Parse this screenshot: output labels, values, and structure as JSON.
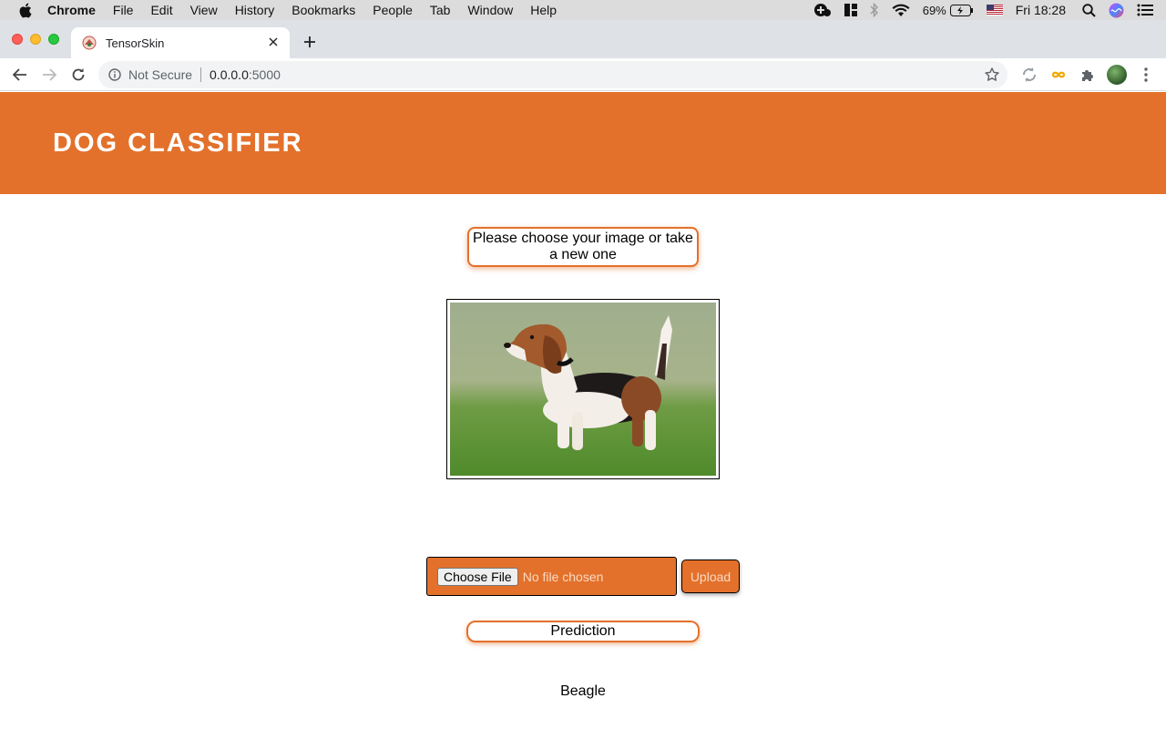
{
  "menubar": {
    "app": "Chrome",
    "items": [
      "File",
      "Edit",
      "View",
      "History",
      "Bookmarks",
      "People",
      "Tab",
      "Window",
      "Help"
    ],
    "battery": "69%",
    "clock": "Fri 18:28"
  },
  "tab": {
    "title": "TensorSkin"
  },
  "omnibox": {
    "security": "Not Secure",
    "host": "0.0.0.0",
    "port": ":5000"
  },
  "page": {
    "header_title": "DOG CLASSIFIER",
    "instruction": "Please choose your image or take a new one",
    "image_subject": "beagle-photo",
    "file_input": {
      "button": "Choose File",
      "status": "No file chosen"
    },
    "upload_label": "Upload",
    "prediction_label": "Prediction",
    "prediction_result": "Beagle"
  },
  "colors": {
    "accent": "#e3712b",
    "muted_text": "#fbd9c3"
  }
}
